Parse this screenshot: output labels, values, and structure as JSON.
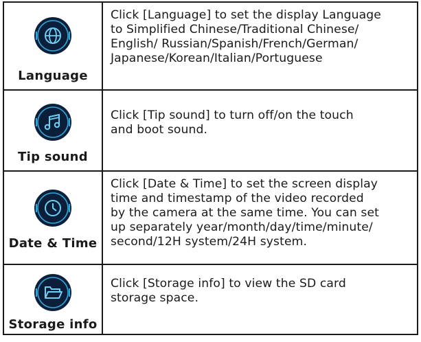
{
  "settings": [
    {
      "label": "Language",
      "icon": "globe-icon",
      "description": "Click [Language] to set the display Language\nto Simplified Chinese/Traditional Chinese/\nEnglish/ Russian/Spanish/French/German/\nJapanese/Korean/Italian/Portuguese"
    },
    {
      "label": "Tip sound",
      "icon": "music-note-icon",
      "description": "Click [Tip sound] to turn off/on the touch\nand boot sound."
    },
    {
      "label": "Date & Time",
      "icon": "clock-icon",
      "description": "Click [Date & Time] to set the screen display\ntime and timestamp of the video recorded\nby the camera at the same time. You can set\nup separately year/month/day/time/minute/\nsecond/12H system/24H system."
    },
    {
      "label": "Storage info",
      "icon": "folder-icon",
      "description": "Click [Storage info] to view the SD card\nstorage space."
    }
  ],
  "colors": {
    "icon_bg": "#0b1f3a",
    "icon_ring": "#2fa8d8",
    "icon_glyph": "#6fd0f5",
    "border": "#1a1a1a"
  }
}
